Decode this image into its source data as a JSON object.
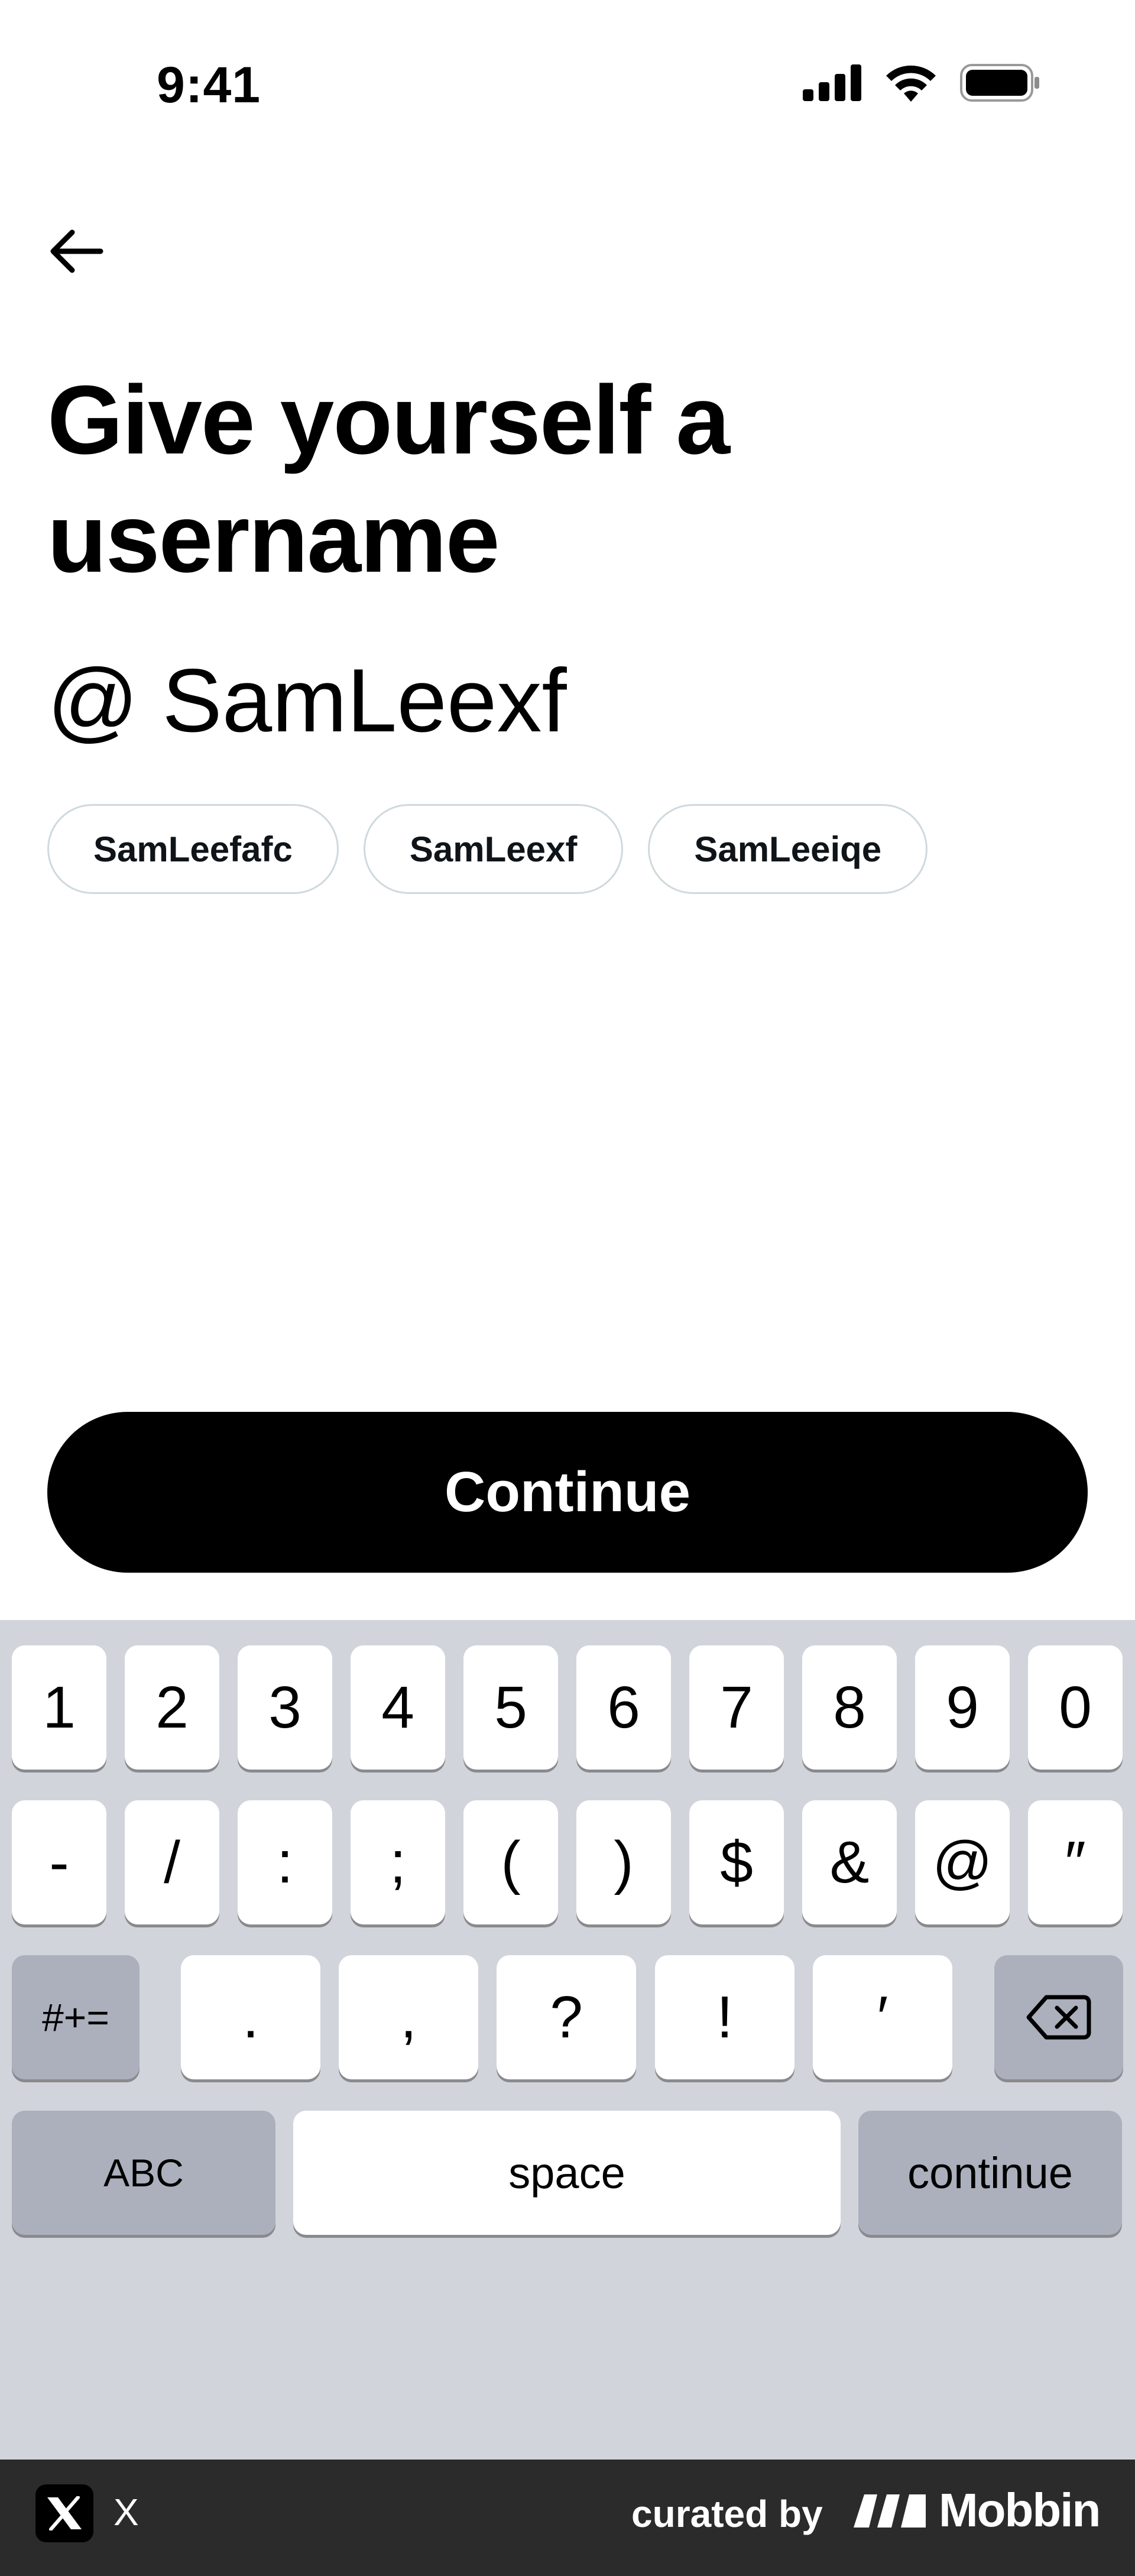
{
  "status_bar": {
    "time": "9:41"
  },
  "title": "Give yourself a username",
  "username": {
    "at": "@",
    "value": "SamLeexf"
  },
  "suggestions": [
    "SamLeefafc",
    "SamLeexf",
    "SamLeeiqe"
  ],
  "continue_label": "Continue",
  "keyboard": {
    "row1": [
      "1",
      "2",
      "3",
      "4",
      "5",
      "6",
      "7",
      "8",
      "9",
      "0"
    ],
    "row2": [
      "-",
      "/",
      ":",
      ";",
      "(",
      ")",
      "$",
      "&",
      "@",
      "″"
    ],
    "row3": [
      "#+=",
      ".",
      ",",
      "?",
      "!",
      "′"
    ],
    "row4": [
      "ABC",
      "space",
      "continue"
    ]
  },
  "footer": {
    "app_name": "X",
    "curated_by": "curated by",
    "brand": "Mobbin"
  },
  "colors": {
    "button": "#000000",
    "chip_border": "#cfd9de",
    "keyboard_bg": "#d1d4db",
    "key_gray": "#abb0bc",
    "footer_bg": "#2b2b2b"
  }
}
